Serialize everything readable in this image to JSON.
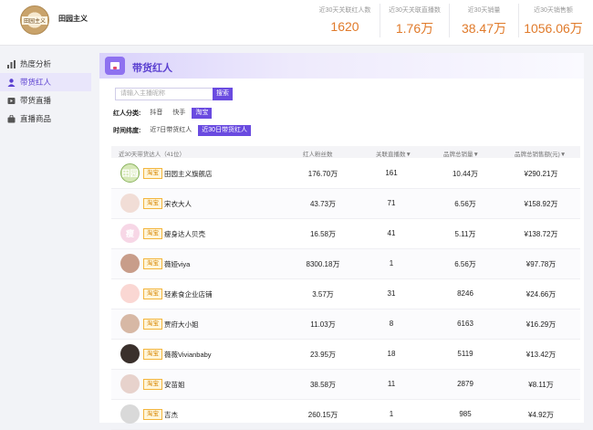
{
  "brand": {
    "logo_text": "田园主义",
    "name": "田园主义"
  },
  "stats": [
    {
      "label": "近30天关联红人数",
      "value": "1620"
    },
    {
      "label": "近30天关联直播数",
      "value": "1.76万"
    },
    {
      "label": "近30天销量",
      "value": "38.47万"
    },
    {
      "label": "近30天销售额",
      "value": "1056.06万"
    }
  ],
  "sidebar": {
    "items": [
      {
        "label": "热度分析",
        "icon": "chart-icon"
      },
      {
        "label": "带货红人",
        "icon": "person-icon"
      },
      {
        "label": "带货直播",
        "icon": "video-icon"
      },
      {
        "label": "直播商品",
        "icon": "bag-icon"
      }
    ]
  },
  "section": {
    "title": "带货红人"
  },
  "search": {
    "placeholder": "请输入主播昵称",
    "button": "搜索"
  },
  "filters": {
    "category_label": "红人分类:",
    "category_options": [
      "抖音",
      "快手",
      "淘宝"
    ],
    "time_label": "时间纬度:",
    "time_options": [
      "近7日带货红人",
      "近30日带货红人"
    ]
  },
  "table": {
    "headers": [
      "近30天带货达人（41位）",
      "红人粉丝数",
      "关联直播数▼",
      "品牌总销量▼",
      "品牌总销售额(元)▼"
    ],
    "rows": [
      {
        "avatar_text": "田园",
        "platform": "淘宝",
        "name": "田园主义旗舰店",
        "fans": "176.70万",
        "lives": "161",
        "sales": "10.44万",
        "revenue": "¥290.21万"
      },
      {
        "avatar_text": "",
        "platform": "淘宝",
        "name": "宋衣大人",
        "fans": "43.73万",
        "lives": "71",
        "sales": "6.56万",
        "revenue": "¥158.92万"
      },
      {
        "avatar_text": "瘦",
        "platform": "淘宝",
        "name": "瘦身达人贝壳",
        "fans": "16.58万",
        "lives": "41",
        "sales": "5.11万",
        "revenue": "¥138.72万"
      },
      {
        "avatar_text": "",
        "platform": "淘宝",
        "name": "薇娅viya",
        "fans": "8300.18万",
        "lives": "1",
        "sales": "6.56万",
        "revenue": "¥97.78万"
      },
      {
        "avatar_text": "",
        "platform": "淘宝",
        "name": "轻素食企业店铺",
        "fans": "3.57万",
        "lives": "31",
        "sales": "8246",
        "revenue": "¥24.66万"
      },
      {
        "avatar_text": "",
        "platform": "淘宝",
        "name": "贾府大小姐",
        "fans": "11.03万",
        "lives": "8",
        "sales": "6163",
        "revenue": "¥16.29万"
      },
      {
        "avatar_text": "",
        "platform": "淘宝",
        "name": "薇薇Vivianbaby",
        "fans": "23.95万",
        "lives": "18",
        "sales": "5119",
        "revenue": "¥13.42万"
      },
      {
        "avatar_text": "",
        "platform": "淘宝",
        "name": "安苗姐",
        "fans": "38.58万",
        "lives": "11",
        "sales": "2879",
        "revenue": "¥8.11万"
      },
      {
        "avatar_text": "",
        "platform": "淘宝",
        "name": "吉杰",
        "fans": "260.15万",
        "lives": "1",
        "sales": "985",
        "revenue": "¥4.92万"
      }
    ]
  }
}
